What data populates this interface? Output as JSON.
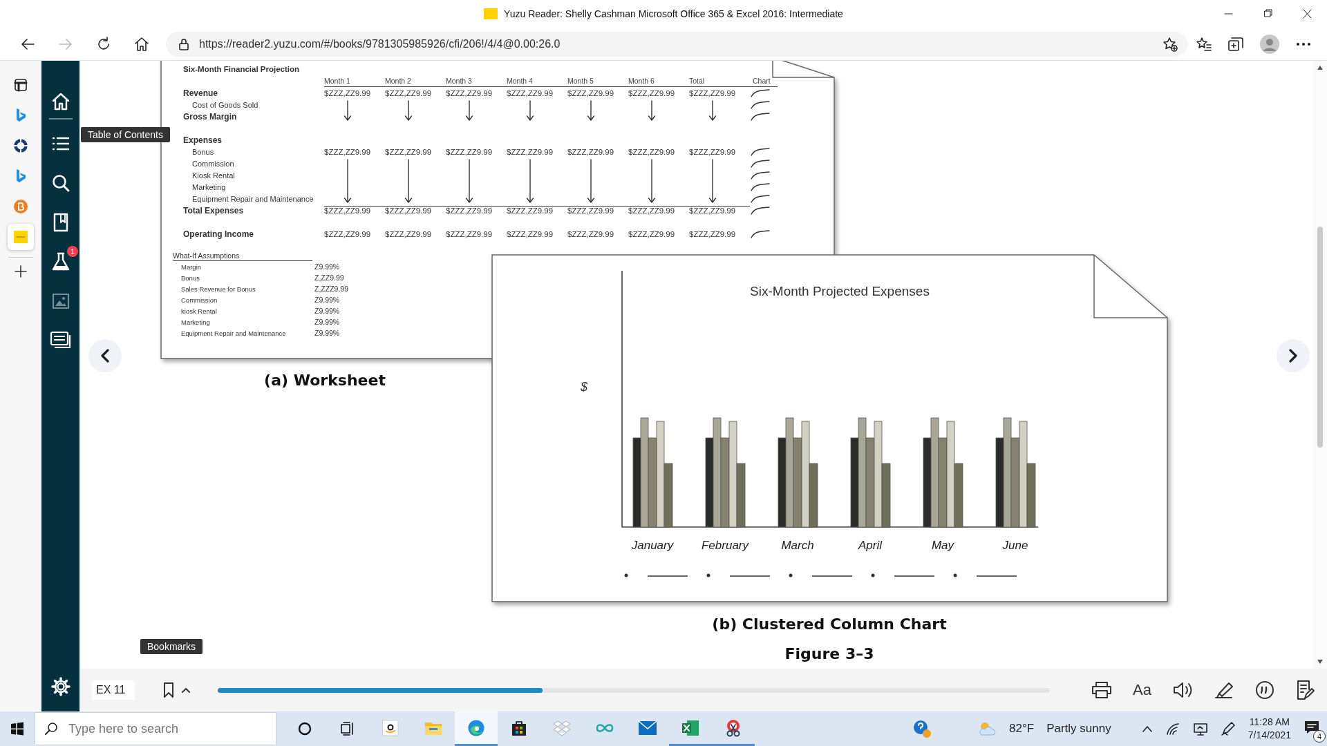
{
  "browser": {
    "title": "Yuzu Reader: Shelly Cashman Microsoft Office 365 & Excel 2016: Intermediate",
    "url": "https://reader2.yuzu.com/#/books/9781305985926/cfi/206!/4/4@0.00:26.0"
  },
  "edge_sidebar": {
    "items": [
      {
        "kind": "tabs",
        "selected": false
      },
      {
        "kind": "bing",
        "selected": false
      },
      {
        "kind": "ring",
        "selected": false
      },
      {
        "kind": "bing",
        "selected": false
      },
      {
        "kind": "orange",
        "selected": false
      },
      {
        "kind": "yuzu",
        "selected": true
      }
    ]
  },
  "nav": {
    "items": [
      {
        "kind": "home",
        "disabled": false
      },
      {
        "kind": "contents",
        "disabled": false
      },
      {
        "kind": "search",
        "disabled": false
      },
      {
        "kind": "bookmark",
        "disabled": false
      },
      {
        "kind": "lab",
        "disabled": false,
        "badge": "1"
      },
      {
        "kind": "images",
        "disabled": true
      },
      {
        "kind": "notes",
        "disabled": false
      }
    ]
  },
  "toc_tooltip": "Table of Contents",
  "bookmarks_tooltip": "Bookmarks",
  "worksheet": {
    "title": "Six-Month Financial Projection",
    "columns": [
      "Month 1",
      "Month 2",
      "Month 3",
      "Month 4",
      "Month 5",
      "Month 6",
      "Total"
    ],
    "chart_column": "Chart",
    "groups": [
      [
        {
          "label": "Revenue",
          "kind": "bold",
          "values": [
            "$ZZZ,ZZ9.99",
            "$ZZZ,ZZ9.99",
            "$ZZZ,ZZ9.99",
            "$ZZZ,ZZ9.99",
            "$ZZZ,ZZ9.99",
            "$ZZZ,ZZ9.99",
            "$ZZZ,ZZ9.99"
          ]
        },
        {
          "label": "Cost of Goods Sold",
          "kind": "item"
        },
        {
          "label": "Gross Margin",
          "kind": "bold"
        }
      ],
      [
        {
          "label": "Expenses",
          "kind": "section"
        },
        {
          "label": "Bonus",
          "kind": "item",
          "values": [
            "$ZZZ,ZZ9.99",
            "$ZZZ,ZZ9.99",
            "$ZZZ,ZZ9.99",
            "$ZZZ,ZZ9.99",
            "$ZZZ,ZZ9.99",
            "$ZZZ,ZZ9.99",
            "$ZZZ,ZZ9.99"
          ]
        },
        {
          "label": "Commission",
          "kind": "item"
        },
        {
          "label": "Kiosk Rental",
          "kind": "item"
        },
        {
          "label": "Marketing",
          "kind": "item"
        },
        {
          "label": "Equipment Repair and Maintenance",
          "kind": "item"
        },
        {
          "label": "Total Expenses",
          "kind": "total",
          "values": [
            "$ZZZ,ZZ9.99",
            "$ZZZ,ZZ9.99",
            "$ZZZ,ZZ9.99",
            "$ZZZ,ZZ9.99",
            "$ZZZ,ZZ9.99",
            "$ZZZ,ZZ9.99",
            "$ZZZ,ZZ9.99"
          ]
        }
      ],
      [
        {
          "label": "Operating Income",
          "kind": "bold",
          "values": [
            "$ZZZ,ZZ9.99",
            "$ZZZ,ZZ9.99",
            "$ZZZ,ZZ9.99",
            "$ZZZ,ZZ9.99",
            "$ZZZ,ZZ9.99",
            "$ZZZ,ZZ9.99",
            "$ZZZ,ZZ9.99"
          ]
        }
      ]
    ],
    "assumptions": {
      "title": "What-If Assumptions",
      "rows": [
        {
          "label": "Margin",
          "value": "Z9.99%"
        },
        {
          "label": "Bonus",
          "value": "Z,ZZ9.99"
        },
        {
          "label": "Sales Revenue for Bonus",
          "value": "Z,ZZZ9.99"
        },
        {
          "label": "Commission",
          "value": "Z9.99%"
        },
        {
          "label": "kiosk Rental",
          "value": "Z9.99%"
        },
        {
          "label": "Marketing",
          "value": "Z9.99%"
        },
        {
          "label": "Equipment Repair and Maintenance",
          "value": "Z9.99%"
        }
      ]
    }
  },
  "worksheet_caption": "(a) Worksheet",
  "chart_page": {
    "title": "Six-Month Projected Expenses",
    "axis_label": "$",
    "categories": [
      "January",
      "February",
      "March",
      "April",
      "May",
      "June"
    ]
  },
  "chart_caption": "(b) Clustered Column Chart",
  "figure_caption": "Figure 3–3",
  "reader_bar": {
    "page_field": "EX 11",
    "progress": {
      "level": 0.39
    },
    "font_button": "Aa"
  },
  "taskbar": {
    "search_placeholder": "Type here to search",
    "apps": [
      {
        "kind": "amazon",
        "running": false,
        "selected": false
      },
      {
        "kind": "folder",
        "running": false,
        "selected": false
      },
      {
        "kind": "edge",
        "running": true,
        "selected": true
      },
      {
        "kind": "store",
        "running": false,
        "selected": false
      },
      {
        "kind": "dropbox",
        "running": false,
        "selected": false
      },
      {
        "kind": "infinity",
        "running": false,
        "selected": false
      },
      {
        "kind": "mail",
        "running": false,
        "selected": false
      },
      {
        "kind": "excel",
        "running": true,
        "selected": false
      },
      {
        "kind": "snip",
        "running": true,
        "selected": false
      }
    ],
    "temperature": "82°F",
    "weather": "Partly sunny",
    "time": "11:28 AM",
    "date": "7/14/2021",
    "notifications": "4"
  }
}
